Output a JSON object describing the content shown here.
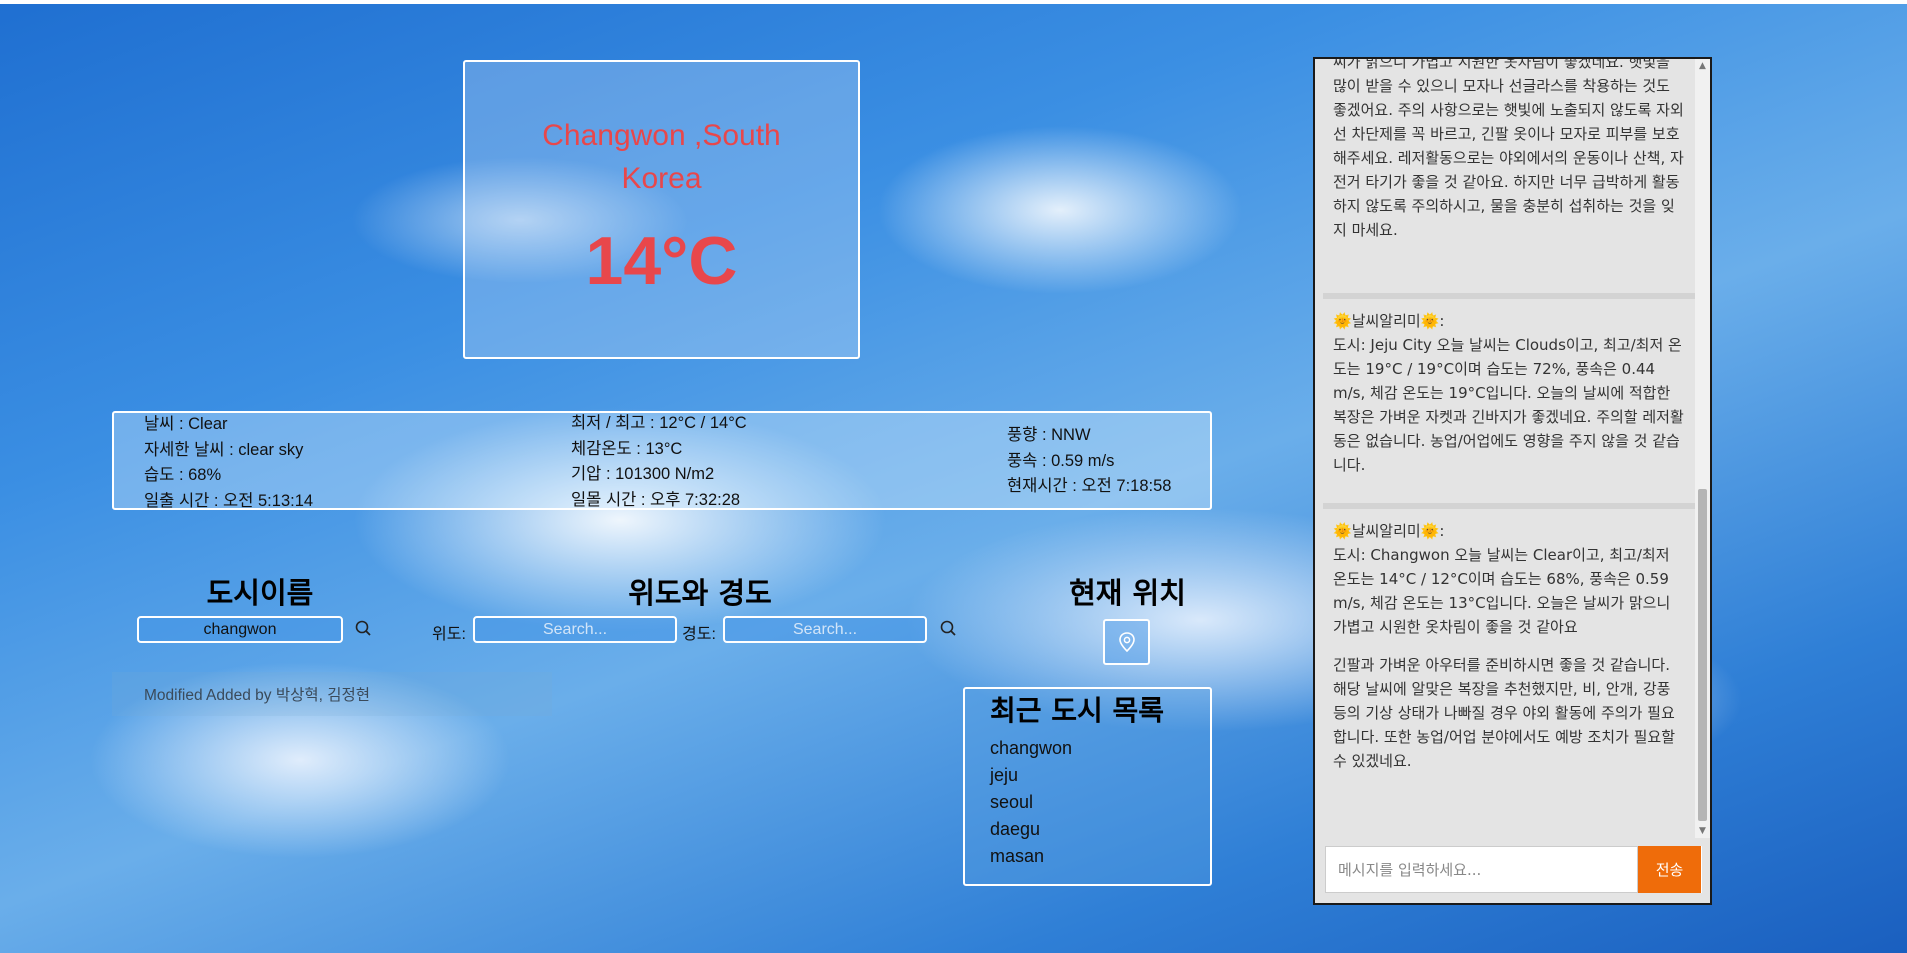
{
  "colors": {
    "accent_red": "#e8474b",
    "send_orange": "#ef6c0a"
  },
  "weather": {
    "city_name": "Changwon ,South Korea",
    "temperature": "14°C",
    "description": "날씨 : Clear",
    "detail": "자세한 날씨 : clear sky",
    "humidity": "습도 : 68%",
    "sunrise": "일출 시간 : 오전 5:13:14",
    "min_max": "최저 / 최고 : 12°C / 14°C",
    "feels_like": "체감온도 : 13°C",
    "pressure": "기압 : 101300 N/m2",
    "sunset": "일몰 시간 : 오후 7:32:28",
    "wind_dir": "풍향 : NNW",
    "wind_speed": "풍속 : 0.59 m/s",
    "current_time": "현재시간 : 오전 7:18:58"
  },
  "search": {
    "city_title": "도시이름",
    "city_value": "changwon",
    "coord_title": "위도와 경도",
    "lat_label": "위도:",
    "lat_placeholder": "Search...",
    "lon_label": "경도:",
    "lon_placeholder": "Search...",
    "location_title": "현재 위치",
    "search_icon": "search-icon",
    "location_icon": "map-pin-icon"
  },
  "credit": "Modified Added by 박상혁, 김정현",
  "recent": {
    "title": "최근 도시 목록",
    "items": [
      "changwon",
      "jeju",
      "seoul",
      "daegu",
      "masan"
    ]
  },
  "chat": {
    "messages": [
      {
        "body": "씨가 맑으니 가볍고 시원한 옷차림이 좋겠네요. 햇빛을 많이 받을 수 있으니 모자나 선글라스를 착용하는 것도 좋겠어요. 주의 사항으로는 햇빛에 노출되지 않도록 자외선 차단제를 꼭 바르고, 긴팔 옷이나 모자로 피부를 보호해주세요. 레저활동으로는 야외에서의 운동이나 산책, 자전거 타기가 좋을 것 같아요. 하지만 너무 급박하게 활동하지 않도록 주의하시고, 물을 충분히 섭취하는 것을 잊지 마세요."
      },
      {
        "sender": "날씨알리미",
        "sun": "🌞",
        "body": "도시: Jeju City 오늘 날씨는 Clouds이고, 최고/최저 온도는 19°C / 19°C이며 습도는 72%, 풍속은 0.44 m/s, 체감 온도는 19°C입니다. 오늘의 날씨에 적합한 복장은 가벼운 자켓과 긴바지가 좋겠네요. 주의할 레저활동은 없습니다. 농업/어업에도 영향을 주지 않을 것 같습니다."
      },
      {
        "sender": "날씨알리미",
        "sun": "🌞",
        "body": "도시: Changwon 오늘 날씨는 Clear이고, 최고/최저 온도는 14°C / 12°C이며 습도는 68%, 풍속은 0.59 m/s, 체감 온도는 13°C입니다. 오늘은 날씨가 맑으니 가볍고 시원한 옷차림이 좋을 것 같아요",
        "body2": "긴팔과 가벼운 아우터를 준비하시면 좋을 것 같습니다. 해당 날씨에 알맞은 복장을 추천했지만, 비, 안개, 강풍 등의 기상 상태가 나빠질 경우 야외 활동에 주의가 필요합니다. 또한 농업/어업 분야에서도 예방 조치가 필요할 수 있겠네요."
      }
    ],
    "input_placeholder": "메시지를 입력하세요...",
    "send_label": "전송"
  }
}
